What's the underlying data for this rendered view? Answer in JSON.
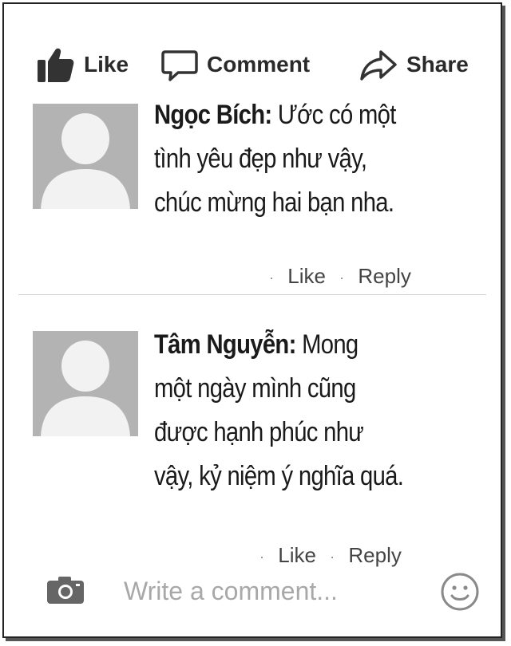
{
  "actions": {
    "like": "Like",
    "comment": "Comment",
    "share": "Share"
  },
  "comments": [
    {
      "author": "Ngọc Bích:",
      "line1": " Ước có một",
      "line2": "tình yêu đẹp như vậy,",
      "line3": "chúc mừng hai bạn nha.",
      "like": "Like",
      "reply": "Reply"
    },
    {
      "author": "Tâm Nguyễn:",
      "line1": " Mong",
      "line2": "một ngày mình cũng",
      "line3": "được hạnh phúc như",
      "line4": "vậy, kỷ niệm ý nghĩa quá.",
      "like": "Like",
      "reply": "Reply"
    }
  ],
  "composer": {
    "placeholder": "Write a comment...",
    "camera_icon": "camera-icon",
    "emoji_icon": "smiley-icon"
  },
  "colors": {
    "icon": "#333333",
    "placeholder": "#a8a8a8",
    "avatar_bg": "#b3b3b3"
  }
}
